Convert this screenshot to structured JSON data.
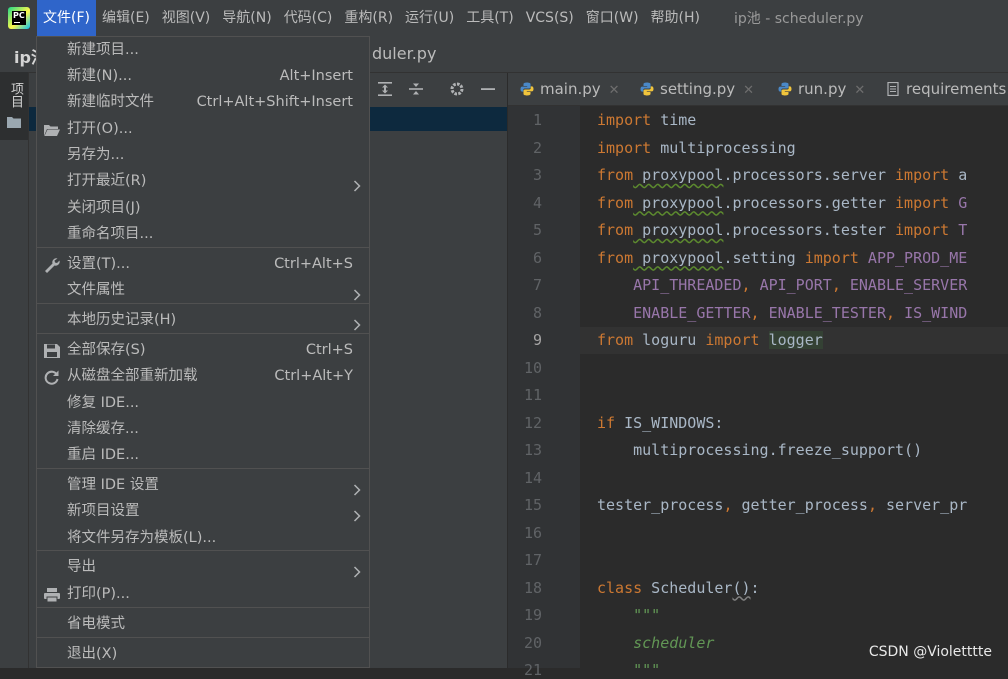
{
  "menubar": {
    "items": [
      "文件(F)",
      "编辑(E)",
      "视图(V)",
      "导航(N)",
      "代码(C)",
      "重构(R)",
      "运行(U)",
      "工具(T)",
      "VCS(S)",
      "窗口(W)",
      "帮助(H)"
    ],
    "window_title": "ip池 - scheduler.py"
  },
  "navbar": {
    "project": "ip池",
    "file": "duler.py"
  },
  "left_strip": {
    "project_label": "项目"
  },
  "file_menu": {
    "items": [
      {
        "label": "新建项目...",
        "shortcut": ""
      },
      {
        "label": "新建(N)...",
        "shortcut": "Alt+Insert"
      },
      {
        "label": "新建临时文件",
        "shortcut": "Ctrl+Alt+Shift+Insert"
      },
      {
        "label": "打开(O)...",
        "shortcut": "",
        "icon": "folder-open-icon"
      },
      {
        "label": "另存为...",
        "shortcut": ""
      },
      {
        "label": "打开最近(R)",
        "shortcut": "",
        "submenu": true
      },
      {
        "label": "关闭项目(J)",
        "shortcut": ""
      },
      {
        "label": "重命名项目...",
        "shortcut": ""
      },
      {
        "label": "设置(T)...",
        "shortcut": "Ctrl+Alt+S",
        "icon": "wrench-icon"
      },
      {
        "label": "文件属性",
        "shortcut": "",
        "submenu": true
      },
      {
        "label": "本地历史记录(H)",
        "shortcut": "",
        "submenu": true
      },
      {
        "label": "全部保存(S)",
        "shortcut": "Ctrl+S",
        "icon": "save-icon"
      },
      {
        "label": "从磁盘全部重新加载",
        "shortcut": "Ctrl+Alt+Y",
        "icon": "reload-icon"
      },
      {
        "label": "修复 IDE...",
        "shortcut": ""
      },
      {
        "label": "清除缓存...",
        "shortcut": ""
      },
      {
        "label": "重启 IDE...",
        "shortcut": ""
      },
      {
        "label": "管理 IDE 设置",
        "shortcut": "",
        "submenu": true
      },
      {
        "label": "新项目设置",
        "shortcut": "",
        "submenu": true
      },
      {
        "label": "将文件另存为模板(L)...",
        "shortcut": ""
      },
      {
        "label": "导出",
        "shortcut": "",
        "submenu": true
      },
      {
        "label": "打印(P)...",
        "shortcut": "",
        "icon": "print-icon"
      },
      {
        "label": "省电模式",
        "shortcut": ""
      },
      {
        "label": "退出(X)",
        "shortcut": ""
      }
    ]
  },
  "editor_tabs": [
    "main.py",
    "setting.py",
    "run.py",
    "requirements."
  ],
  "code": {
    "line_numbers": [
      "1",
      "2",
      "3",
      "4",
      "5",
      "6",
      "7",
      "8",
      "9",
      "10",
      "11",
      "12",
      "13",
      "14",
      "15",
      "16",
      "17",
      "18",
      "19",
      "20",
      "21"
    ],
    "current_line": "9",
    "lines": [
      [
        "import",
        " time"
      ],
      [
        "import",
        " multiprocessing"
      ],
      [
        "from",
        " proxypool",
        ".processors.server ",
        "import",
        " a"
      ],
      [
        "from",
        " proxypool",
        ".processors.getter ",
        "import",
        " G"
      ],
      [
        "from",
        " proxypool",
        ".processors.tester ",
        "import",
        " T"
      ],
      [
        "from",
        " proxypool",
        ".setting ",
        "import",
        " APP_PROD_ME"
      ],
      [
        "    API_THREADED",
        ", ",
        "API_PORT",
        ", ",
        "ENABLE_SERVER"
      ],
      [
        "    ENABLE_GETTER",
        ", ",
        "ENABLE_TESTER",
        ", ",
        "IS_WIND"
      ],
      [
        "from",
        " loguru ",
        "import",
        " ",
        "logger"
      ],
      [],
      [],
      [
        "if",
        " IS_WINDOWS:"
      ],
      [
        "    multiprocessing.freeze_support()"
      ],
      [],
      [
        "tester_process",
        ", ",
        "getter_process",
        ", ",
        "server_pr"
      ],
      [],
      [],
      [
        "class",
        " Scheduler",
        "()",
        ":"
      ],
      [
        "    \"\"\""
      ],
      [
        "    scheduler"
      ],
      [
        "    \"\"\""
      ]
    ]
  },
  "watermark": "CSDN @Violetttte",
  "colors": {
    "menu_active": "#2f65ca",
    "keyword": "#cc7832",
    "string": "#629755"
  }
}
